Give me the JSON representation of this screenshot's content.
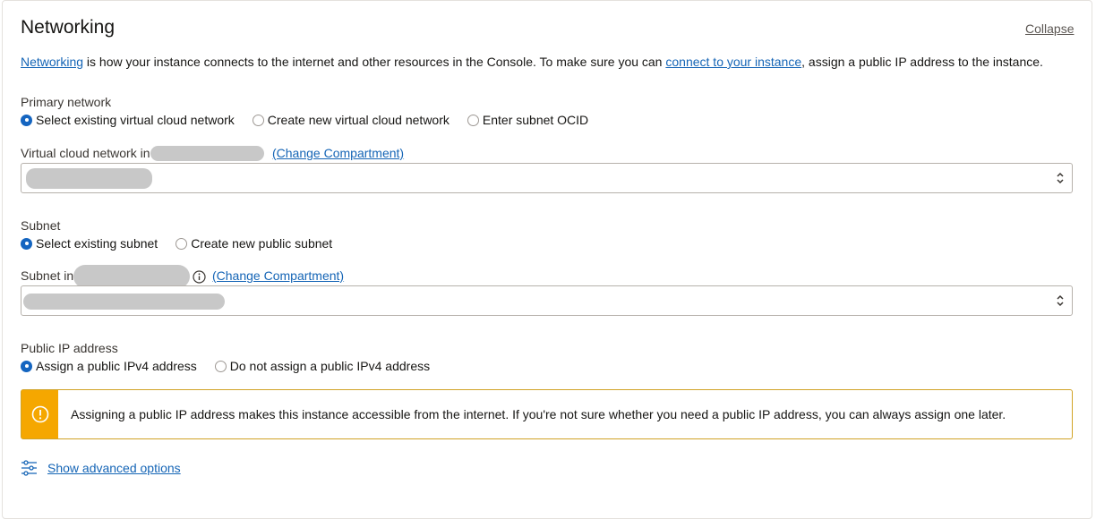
{
  "section": {
    "title": "Networking",
    "collapse_label": "Collapse"
  },
  "intro": {
    "link1": "Networking",
    "text1": " is how your instance connects to the internet and other resources in the Console. To make sure you can ",
    "link2": "connect to your instance",
    "text2": ", assign a public IP address to the instance."
  },
  "primary_network": {
    "label": "Primary network",
    "options": [
      {
        "label": "Select existing virtual cloud network",
        "checked": true
      },
      {
        "label": "Create new virtual cloud network",
        "checked": false
      },
      {
        "label": "Enter subnet OCID",
        "checked": false
      }
    ]
  },
  "vcn": {
    "label": "Virtual cloud network in",
    "change_compartment": "(Change Compartment)"
  },
  "subnet_group": {
    "label": "Subnet",
    "options": [
      {
        "label": "Select existing subnet",
        "checked": true
      },
      {
        "label": "Create new public subnet",
        "checked": false
      }
    ]
  },
  "subnet": {
    "label": "Subnet in",
    "change_compartment": "(Change Compartment)"
  },
  "public_ip": {
    "label": "Public IP address",
    "options": [
      {
        "label": "Assign a public IPv4 address",
        "checked": true
      },
      {
        "label": "Do not assign a public IPv4 address",
        "checked": false
      }
    ]
  },
  "alert": {
    "text": "Assigning a public IP address makes this instance accessible from the internet. If you're not sure whether you need a public IP address, you can always assign one later.",
    "icon": "warning-icon",
    "color": "#f5a700"
  },
  "advanced": {
    "label": "Show advanced options",
    "icon": "sliders-icon"
  },
  "colors": {
    "accent": "#1565c0",
    "link": "#1565b6",
    "warning": "#f5a700"
  }
}
